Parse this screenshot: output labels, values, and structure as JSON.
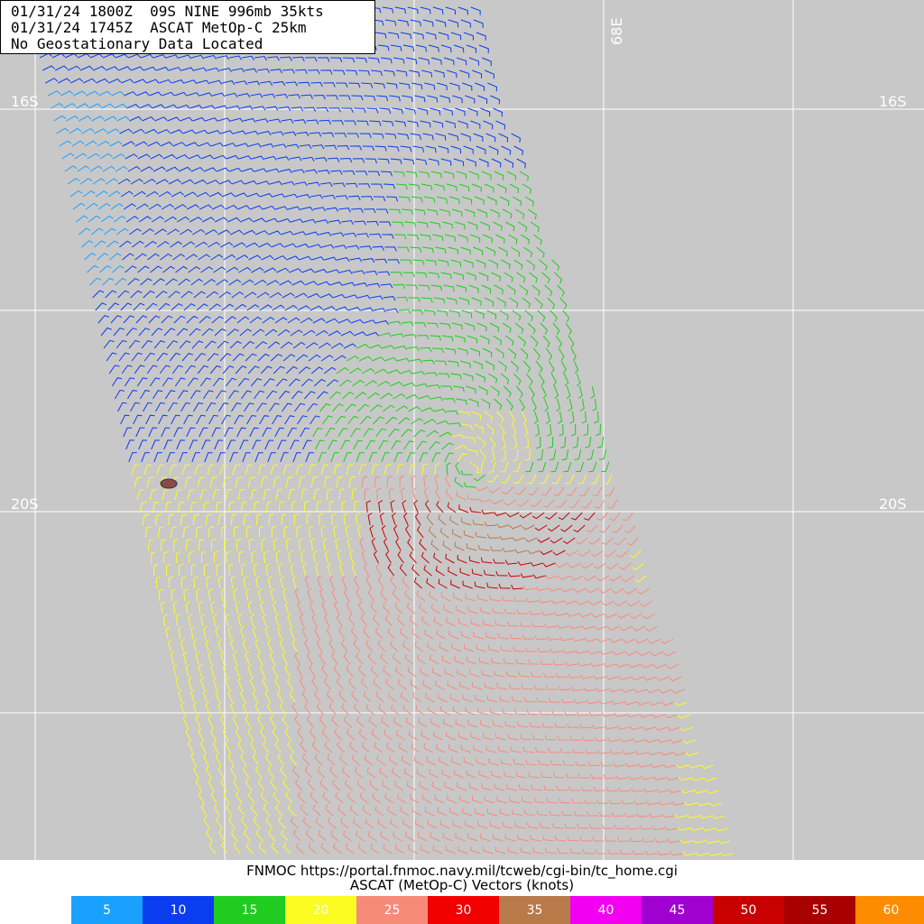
{
  "header": {
    "line1": "01/31/24 1800Z  09S NINE 996mb 35kts",
    "line2": "01/31/24 1745Z  ASCAT MetOp-C 25km",
    "line3": "No Geostationary Data Located"
  },
  "grid": {
    "lat_left": [
      "16S",
      "20S"
    ],
    "lat_right": [
      "16S",
      "20S"
    ],
    "lon_top": [
      "68E"
    ]
  },
  "footer": {
    "credit": "FNMOC https://portal.fnmoc.navy.mil/tcweb/cgi-bin/tc_home.cgi",
    "legend_title": "ASCAT (MetOp-C) Vectors (knots)"
  },
  "legend": [
    {
      "label": "5",
      "color": "#1aa0ff"
    },
    {
      "label": "10",
      "color": "#0a3cf0"
    },
    {
      "label": "15",
      "color": "#1fcc1f"
    },
    {
      "label": "20",
      "color": "#fcfc22"
    },
    {
      "label": "25",
      "color": "#f88a7a"
    },
    {
      "label": "30",
      "color": "#f20000"
    },
    {
      "label": "35",
      "color": "#b97a4a"
    },
    {
      "label": "40",
      "color": "#f200f2"
    },
    {
      "label": "45",
      "color": "#a000d0"
    },
    {
      "label": "50",
      "color": "#c80000"
    },
    {
      "label": "55",
      "color": "#a80000"
    },
    {
      "label": "60",
      "color": "#ff8c00"
    }
  ],
  "map_colors": {
    "background": "#c8c8c8",
    "grid": "#ffffff",
    "island": "#8b4a4a"
  }
}
